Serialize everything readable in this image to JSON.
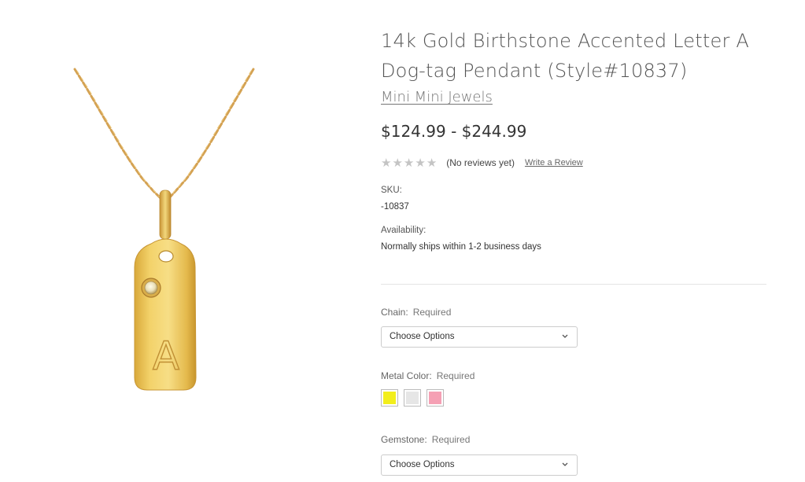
{
  "product": {
    "title": "14k Gold Birthstone Accented Letter A Dog-tag Pendant (Style#10837)",
    "brand": "Mini Mini Jewels",
    "price": "$124.99 - $244.99",
    "image_icon": "pendant-necklace-image",
    "pendant_letter": "A"
  },
  "reviews": {
    "rating": 0,
    "max_rating": 5,
    "stars": [
      "★",
      "★",
      "★",
      "★",
      "★"
    ],
    "summary": "(No reviews yet)",
    "write_link": "Write a Review"
  },
  "details": {
    "sku_label": "SKU:",
    "sku_value": "-10837",
    "availability_label": "Availability:",
    "availability_value": "Normally ships within 1-2 business days"
  },
  "options": {
    "chain": {
      "label": "Chain:",
      "required": "Required",
      "value": "Choose Options"
    },
    "metal_color": {
      "label": "Metal Color:",
      "required": "Required",
      "swatches": [
        {
          "name": "yellow",
          "color": "#f2ee1c"
        },
        {
          "name": "white",
          "color": "#e6e6e6"
        },
        {
          "name": "rose",
          "color": "#f5a0b4"
        }
      ]
    },
    "gemstone": {
      "label": "Gemstone:",
      "required": "Required",
      "value": "Choose Options"
    }
  },
  "colors": {
    "gold_light": "#f6dc7d",
    "gold_mid": "#e9c257",
    "gold_dark": "#c9972f",
    "chain": "#d8a85a"
  }
}
